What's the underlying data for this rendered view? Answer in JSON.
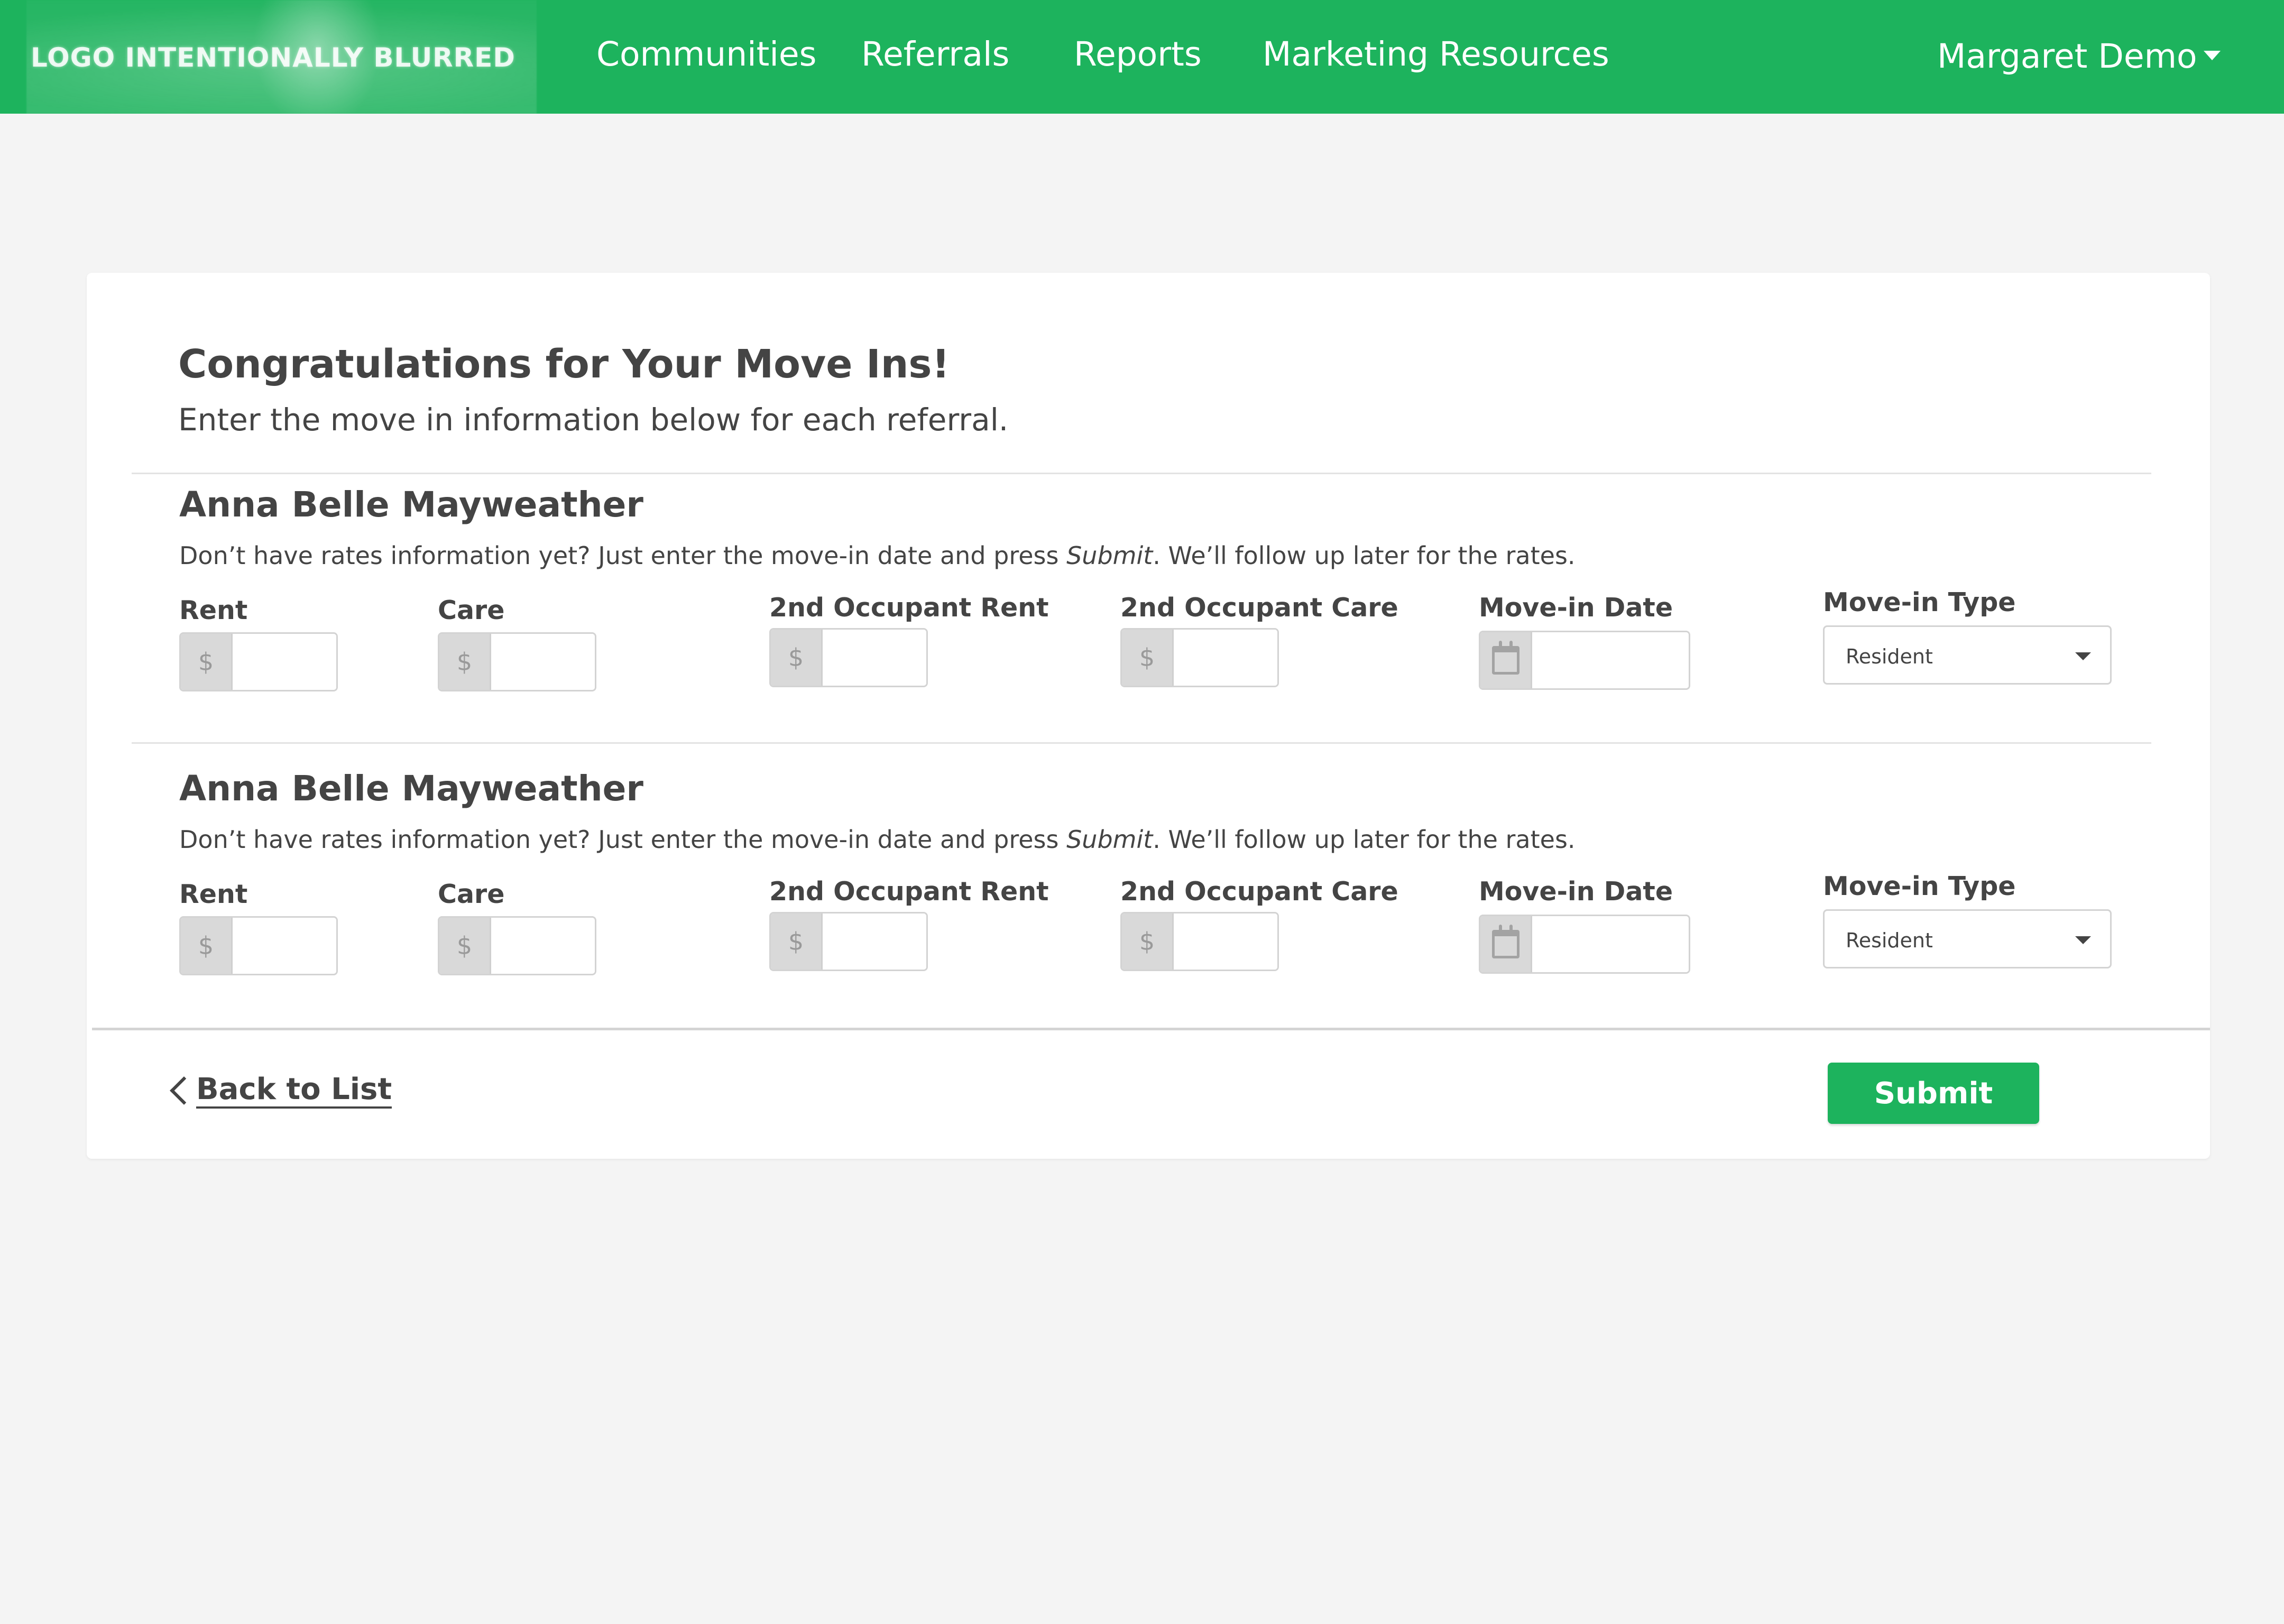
{
  "nav": {
    "logo_text": "LOGO INTENTIONALLY BLURRED",
    "items": [
      "Communities",
      "Referrals",
      "Reports",
      "Marketing Resources"
    ],
    "user_name": "Margaret Demo"
  },
  "page": {
    "title": "Congratulations for Your Move Ins!",
    "subtitle": "Enter the move in information below for each referral."
  },
  "fields": {
    "rent_label": "Rent",
    "care_label": "Care",
    "occ_rent_label": "2nd Occupant Rent",
    "occ_care_label": "2nd Occupant Care",
    "move_in_date_label": "Move-in Date",
    "move_in_type_label": "Move-in Type",
    "currency_symbol": "$"
  },
  "note": {
    "before": "Don’t have rates information yet? Just enter the move-in date and press ",
    "emphasis": "Submit",
    "after": ". We’ll follow up later for the rates."
  },
  "referrals": [
    {
      "name": "Anna Belle Mayweather",
      "rent": "",
      "care": "",
      "occ_rent": "",
      "occ_care": "",
      "move_in_date": "",
      "move_in_type": "Resident"
    },
    {
      "name": "Anna Belle Mayweather",
      "rent": "",
      "care": "",
      "occ_rent": "",
      "occ_care": "",
      "move_in_date": "",
      "move_in_type": "Resident"
    }
  ],
  "footer": {
    "back_label": "Back to List",
    "submit_label": "Submit"
  },
  "colors": {
    "brand_green": "#1db35d",
    "background": "#f4f4f4",
    "text": "#444444"
  },
  "icons": {
    "currency": "dollar-sign",
    "date": "calendar-icon",
    "select": "caret-down-icon",
    "back": "chevron-left-icon"
  }
}
